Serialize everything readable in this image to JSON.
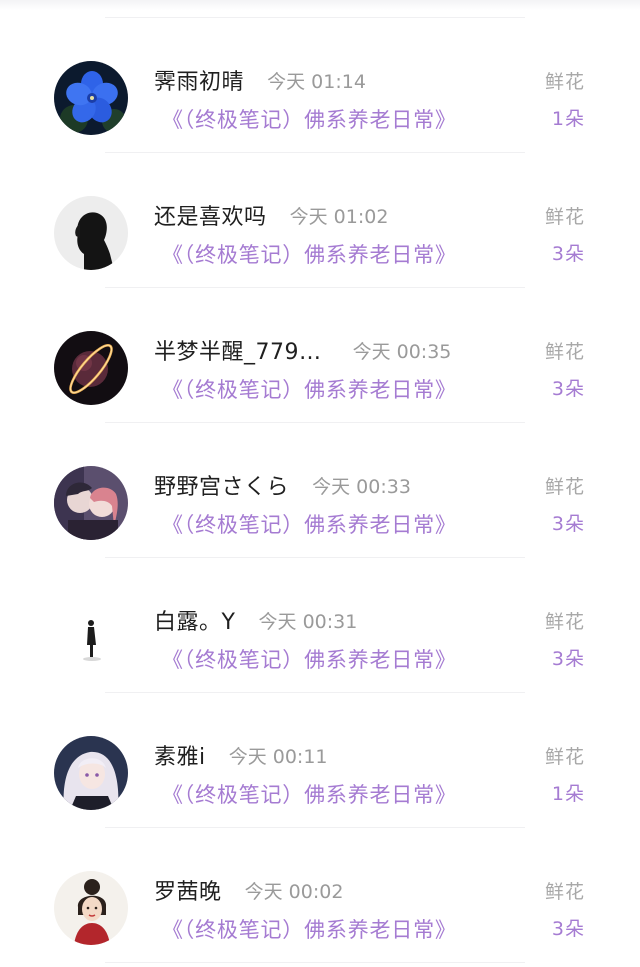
{
  "colors": {
    "accent_purple": "#a57bd2",
    "name_text": "#1f1f1f",
    "muted_text": "#9a9a9a"
  },
  "gift_records": [
    {
      "user": "霁雨初晴",
      "time": "今天 01:14",
      "book": "《（终极笔记）佛系养老日常》",
      "gift_label": "鲜花",
      "gift_count": "1朵",
      "avatar": "blue-flower-avatar"
    },
    {
      "user": "还是喜欢吗",
      "time": "今天 01:02",
      "book": "《（终极笔记）佛系养老日常》",
      "gift_label": "鲜花",
      "gift_count": "3朵",
      "avatar": "silhouette-avatar"
    },
    {
      "user": "半梦半醒_779…",
      "time": "今天 00:35",
      "book": "《（终极笔记）佛系养老日常》",
      "gift_label": "鲜花",
      "gift_count": "3朵",
      "avatar": "planet-ring-avatar"
    },
    {
      "user": "野野宫さくら",
      "time": "今天 00:33",
      "book": "《（终极笔记）佛系养老日常》",
      "gift_label": "鲜花",
      "gift_count": "3朵",
      "avatar": "anime-couple-avatar"
    },
    {
      "user": "白露。Y",
      "time": "今天 00:31",
      "book": "《（终极笔记）佛系养老日常》",
      "gift_label": "鲜花",
      "gift_count": "3朵",
      "avatar": "small-figure-avatar"
    },
    {
      "user": "素雅i",
      "time": "今天 00:11",
      "book": "《（终极笔记）佛系养老日常》",
      "gift_label": "鲜花",
      "gift_count": "1朵",
      "avatar": "anime-girl-avatar"
    },
    {
      "user": "罗茜晚",
      "time": "今天 00:02",
      "book": "《（终极笔记）佛系养老日常》",
      "gift_label": "鲜花",
      "gift_count": "3朵",
      "avatar": "illustrated-woman-avatar"
    }
  ]
}
